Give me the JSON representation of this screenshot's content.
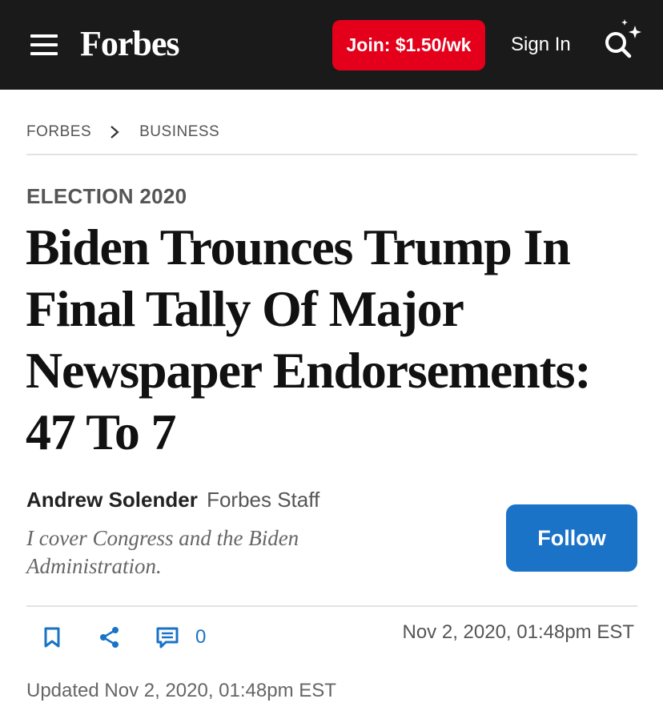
{
  "header": {
    "logo": "Forbes",
    "join_label": "Join: $1.50/wk",
    "signin_label": "Sign In",
    "colors": {
      "bar": "#1a1a1a",
      "join": "#e4001b"
    }
  },
  "breadcrumb": {
    "items": [
      "FORBES",
      "BUSINESS"
    ]
  },
  "article": {
    "kicker": "ELECTION 2020",
    "headline": "Biden Trounces Trump In Final Tally Of Major Newspaper Endorsements: 47 To 7"
  },
  "author": {
    "name": "Andrew Solender",
    "role": "Forbes Staff",
    "bio": "I cover Congress and the Biden Administration.",
    "follow_label": "Follow",
    "follow_color": "#1a73c7"
  },
  "actions": {
    "comment_count": "0",
    "icons": [
      "bookmark-icon",
      "share-icon",
      "comment-icon"
    ]
  },
  "meta": {
    "published": "Nov 2, 2020,  01:48pm EST",
    "updated": "Updated Nov 2, 2020, 01:48pm EST"
  }
}
